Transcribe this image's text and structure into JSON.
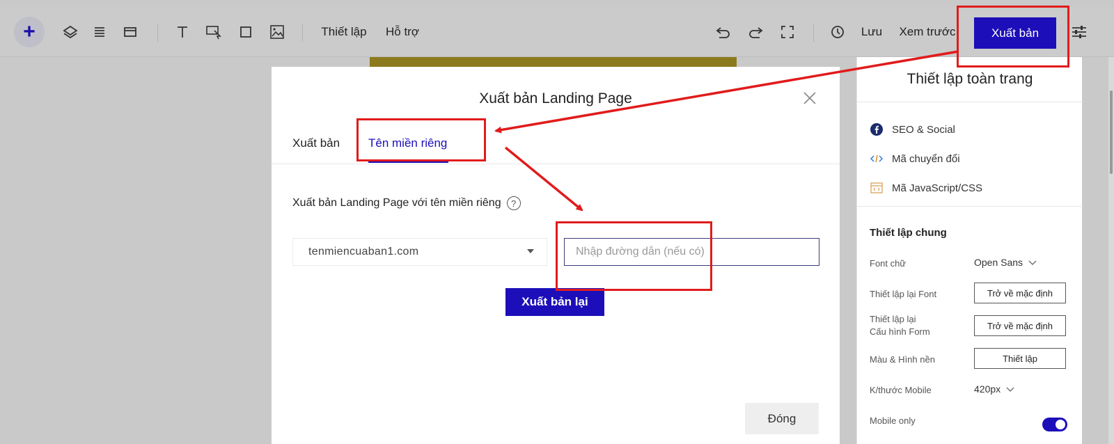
{
  "toolbar": {
    "add_label": "+",
    "settings_label": "Thiết lập",
    "help_label": "Hỗ trợ",
    "save_label": "Lưu",
    "preview_label": "Xem trước",
    "publish_label": "Xuất bản"
  },
  "modal": {
    "title": "Xuất bản Landing Page",
    "tabs": [
      {
        "label": "Xuất bản",
        "active": false
      },
      {
        "label": "Tên miền riêng",
        "active": true
      }
    ],
    "description": "Xuất bản Landing Page với tên miền riêng",
    "help_glyph": "?",
    "domain_select": {
      "value": "tenmiencuaban1.com"
    },
    "path_input": {
      "placeholder": "Nhập đường dẫn (nếu có)",
      "value": ""
    },
    "republish_label": "Xuất bản lại",
    "close_label": "Đóng"
  },
  "panel": {
    "title": "Thiết lập toàn trang",
    "links": [
      {
        "label": "SEO & Social",
        "icon": "facebook-icon"
      },
      {
        "label": "Mã chuyển đổi",
        "icon": "code-icon"
      },
      {
        "label": "Mã JavaScript/CSS",
        "icon": "script-icon"
      }
    ],
    "section_title": "Thiết lập chung",
    "font": {
      "label": "Font chữ",
      "value": "Open Sans"
    },
    "reset_font": {
      "label": "Thiết lập lại Font",
      "button": "Trở về mặc định"
    },
    "reset_form": {
      "label_line1": "Thiết lập lại",
      "label_line2": "Cấu hình Form",
      "button": "Trở về mặc định"
    },
    "background": {
      "label": "Màu & Hình nền",
      "button": "Thiết lập"
    },
    "mobile_size": {
      "label": "K/thước Mobile",
      "value": "420px"
    },
    "mobile_only": {
      "label": "Mobile only",
      "enabled": true
    }
  },
  "colors": {
    "accent": "#1c0fb9",
    "annotation": "#e11b1b",
    "page_strip": "#8c7a1e"
  }
}
